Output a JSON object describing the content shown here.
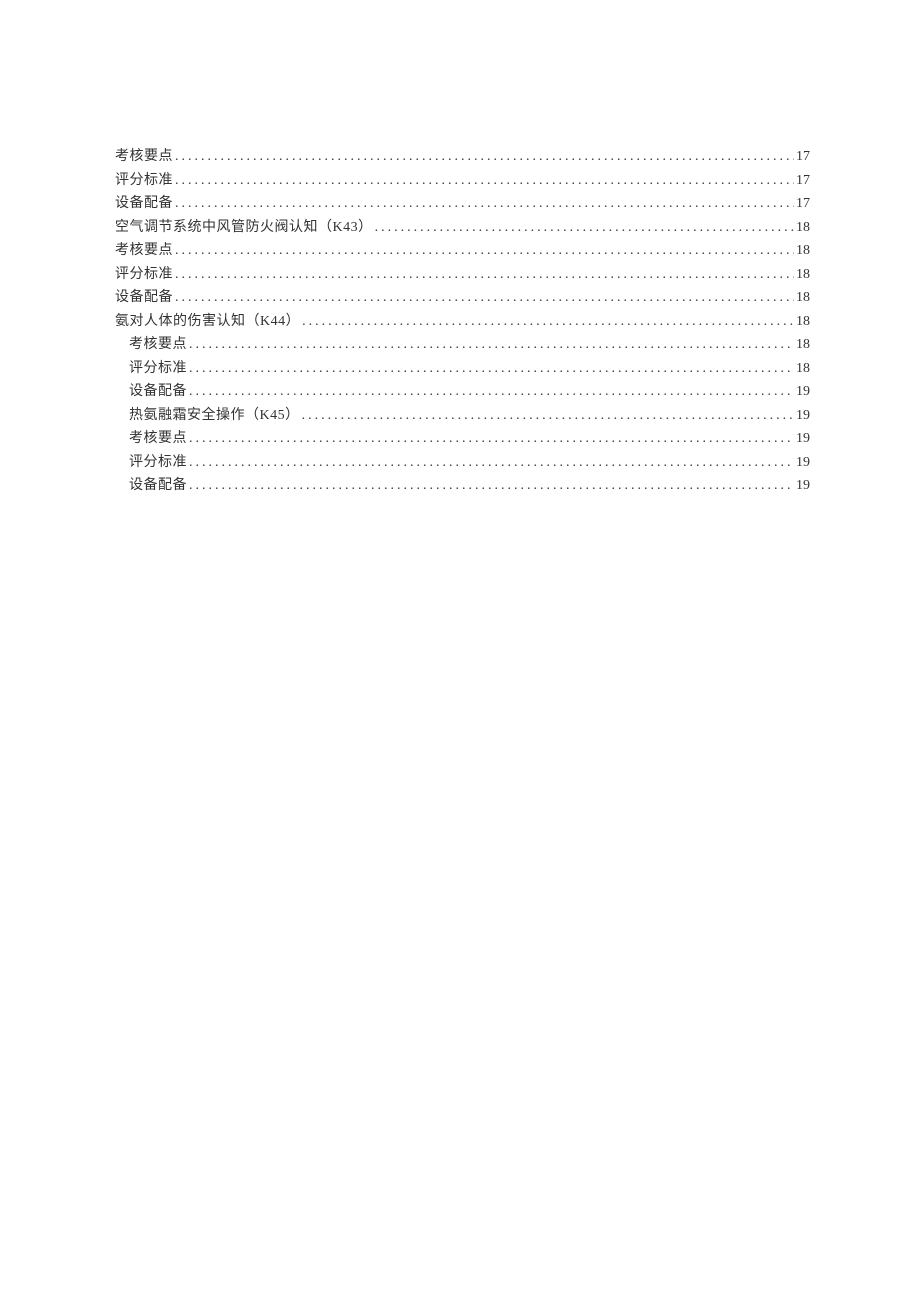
{
  "toc": [
    {
      "level": 1,
      "title": "考核要点",
      "page": "17"
    },
    {
      "level": 1,
      "title": "评分标准",
      "page": "17"
    },
    {
      "level": 1,
      "title": "设备配备",
      "page": "17"
    },
    {
      "level": 1,
      "title": "空气调节系统中风管防火阀认知（K43）",
      "page": "18"
    },
    {
      "level": 1,
      "title": "考核要点",
      "page": "18"
    },
    {
      "level": 1,
      "title": "评分标准",
      "page": "18"
    },
    {
      "level": 1,
      "title": "设备配备",
      "page": "18"
    },
    {
      "level": 1,
      "title": "氨对人体的伤害认知（K44）",
      "page": "18"
    },
    {
      "level": 2,
      "title": "考核要点",
      "page": "18"
    },
    {
      "level": 2,
      "title": "评分标准",
      "page": "18"
    },
    {
      "level": 2,
      "title": "设备配备",
      "page": "19"
    },
    {
      "level": 2,
      "title": "热氨融霜安全操作（K45）",
      "page": "19"
    },
    {
      "level": 2,
      "title": "考核要点",
      "page": "19"
    },
    {
      "level": 2,
      "title": "评分标准",
      "page": "19"
    },
    {
      "level": 2,
      "title": "设备配备",
      "page": "19"
    }
  ]
}
